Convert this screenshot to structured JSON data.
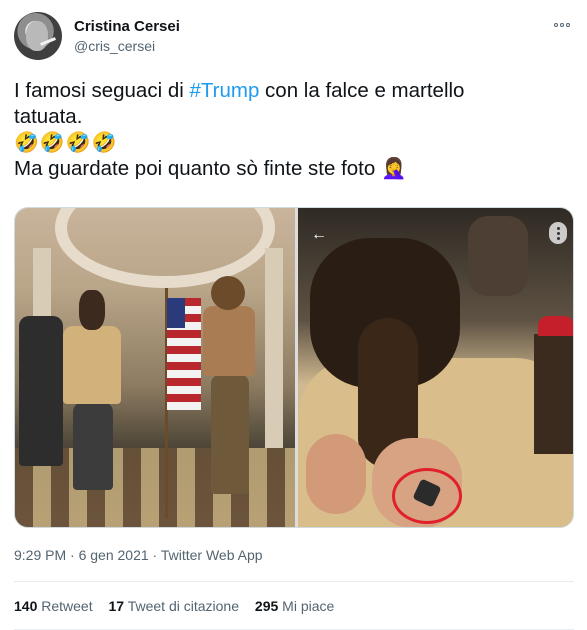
{
  "author": {
    "name": "Cristina Cersei",
    "handle": "@cris_cersei"
  },
  "tweet": {
    "line1_before": "I famosi seguaci di ",
    "line1_hashtag": "#Trump",
    "line1_after": " con la falce e martello",
    "line2": "tatuata.",
    "line3_emojis": "🤣🤣🤣🤣",
    "line4": "Ma guardate poi quanto sò finte ste foto 🤦‍♀️"
  },
  "meta": "9:29 PM · 6 gen 2021 · Twitter Web App",
  "stats": {
    "retweets_count": "140",
    "retweets_label": "Retweet",
    "quotes_count": "17",
    "quotes_label": "Tweet di citazione",
    "likes_count": "295",
    "likes_label": "Mi piace"
  },
  "icons": {
    "more": "more-options-icon",
    "back": "back-arrow-icon",
    "media_menu": "media-options-icon"
  },
  "colors": {
    "accent": "#1d9bf0",
    "text": "#0f1419",
    "secondary": "#536471",
    "highlight_circle": "#e0202a"
  }
}
